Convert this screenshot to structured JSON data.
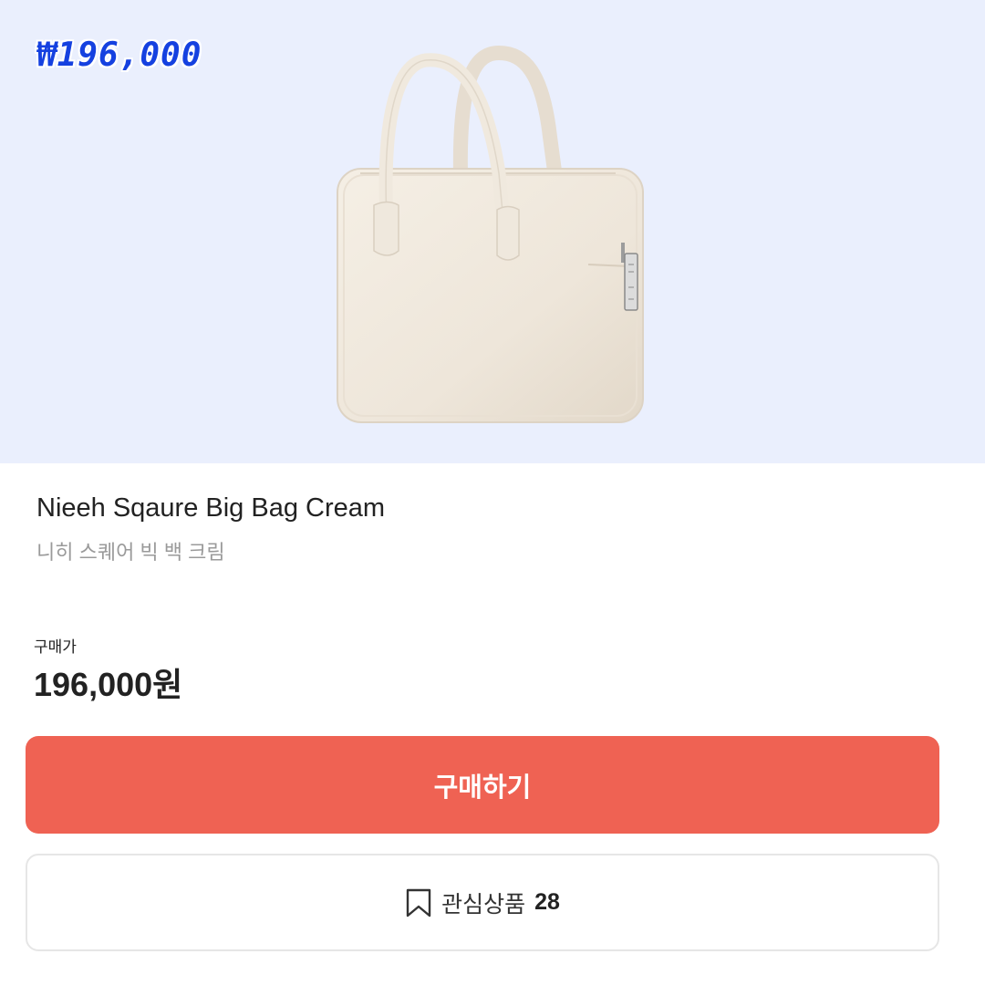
{
  "hero": {
    "price_tag": "₩196,000",
    "image_alt": "cream square big bag"
  },
  "product": {
    "name_en": "Nieeh Sqaure Big Bag Cream",
    "name_ko": "니히 스퀘어 빅 백 크림"
  },
  "price": {
    "label": "구매가",
    "value": "196,000원"
  },
  "actions": {
    "buy_label": "구매하기",
    "buy_color": "#ef6253",
    "wish_label": "관심상품",
    "wish_count": "28",
    "wish_icon": "bookmark-icon"
  }
}
